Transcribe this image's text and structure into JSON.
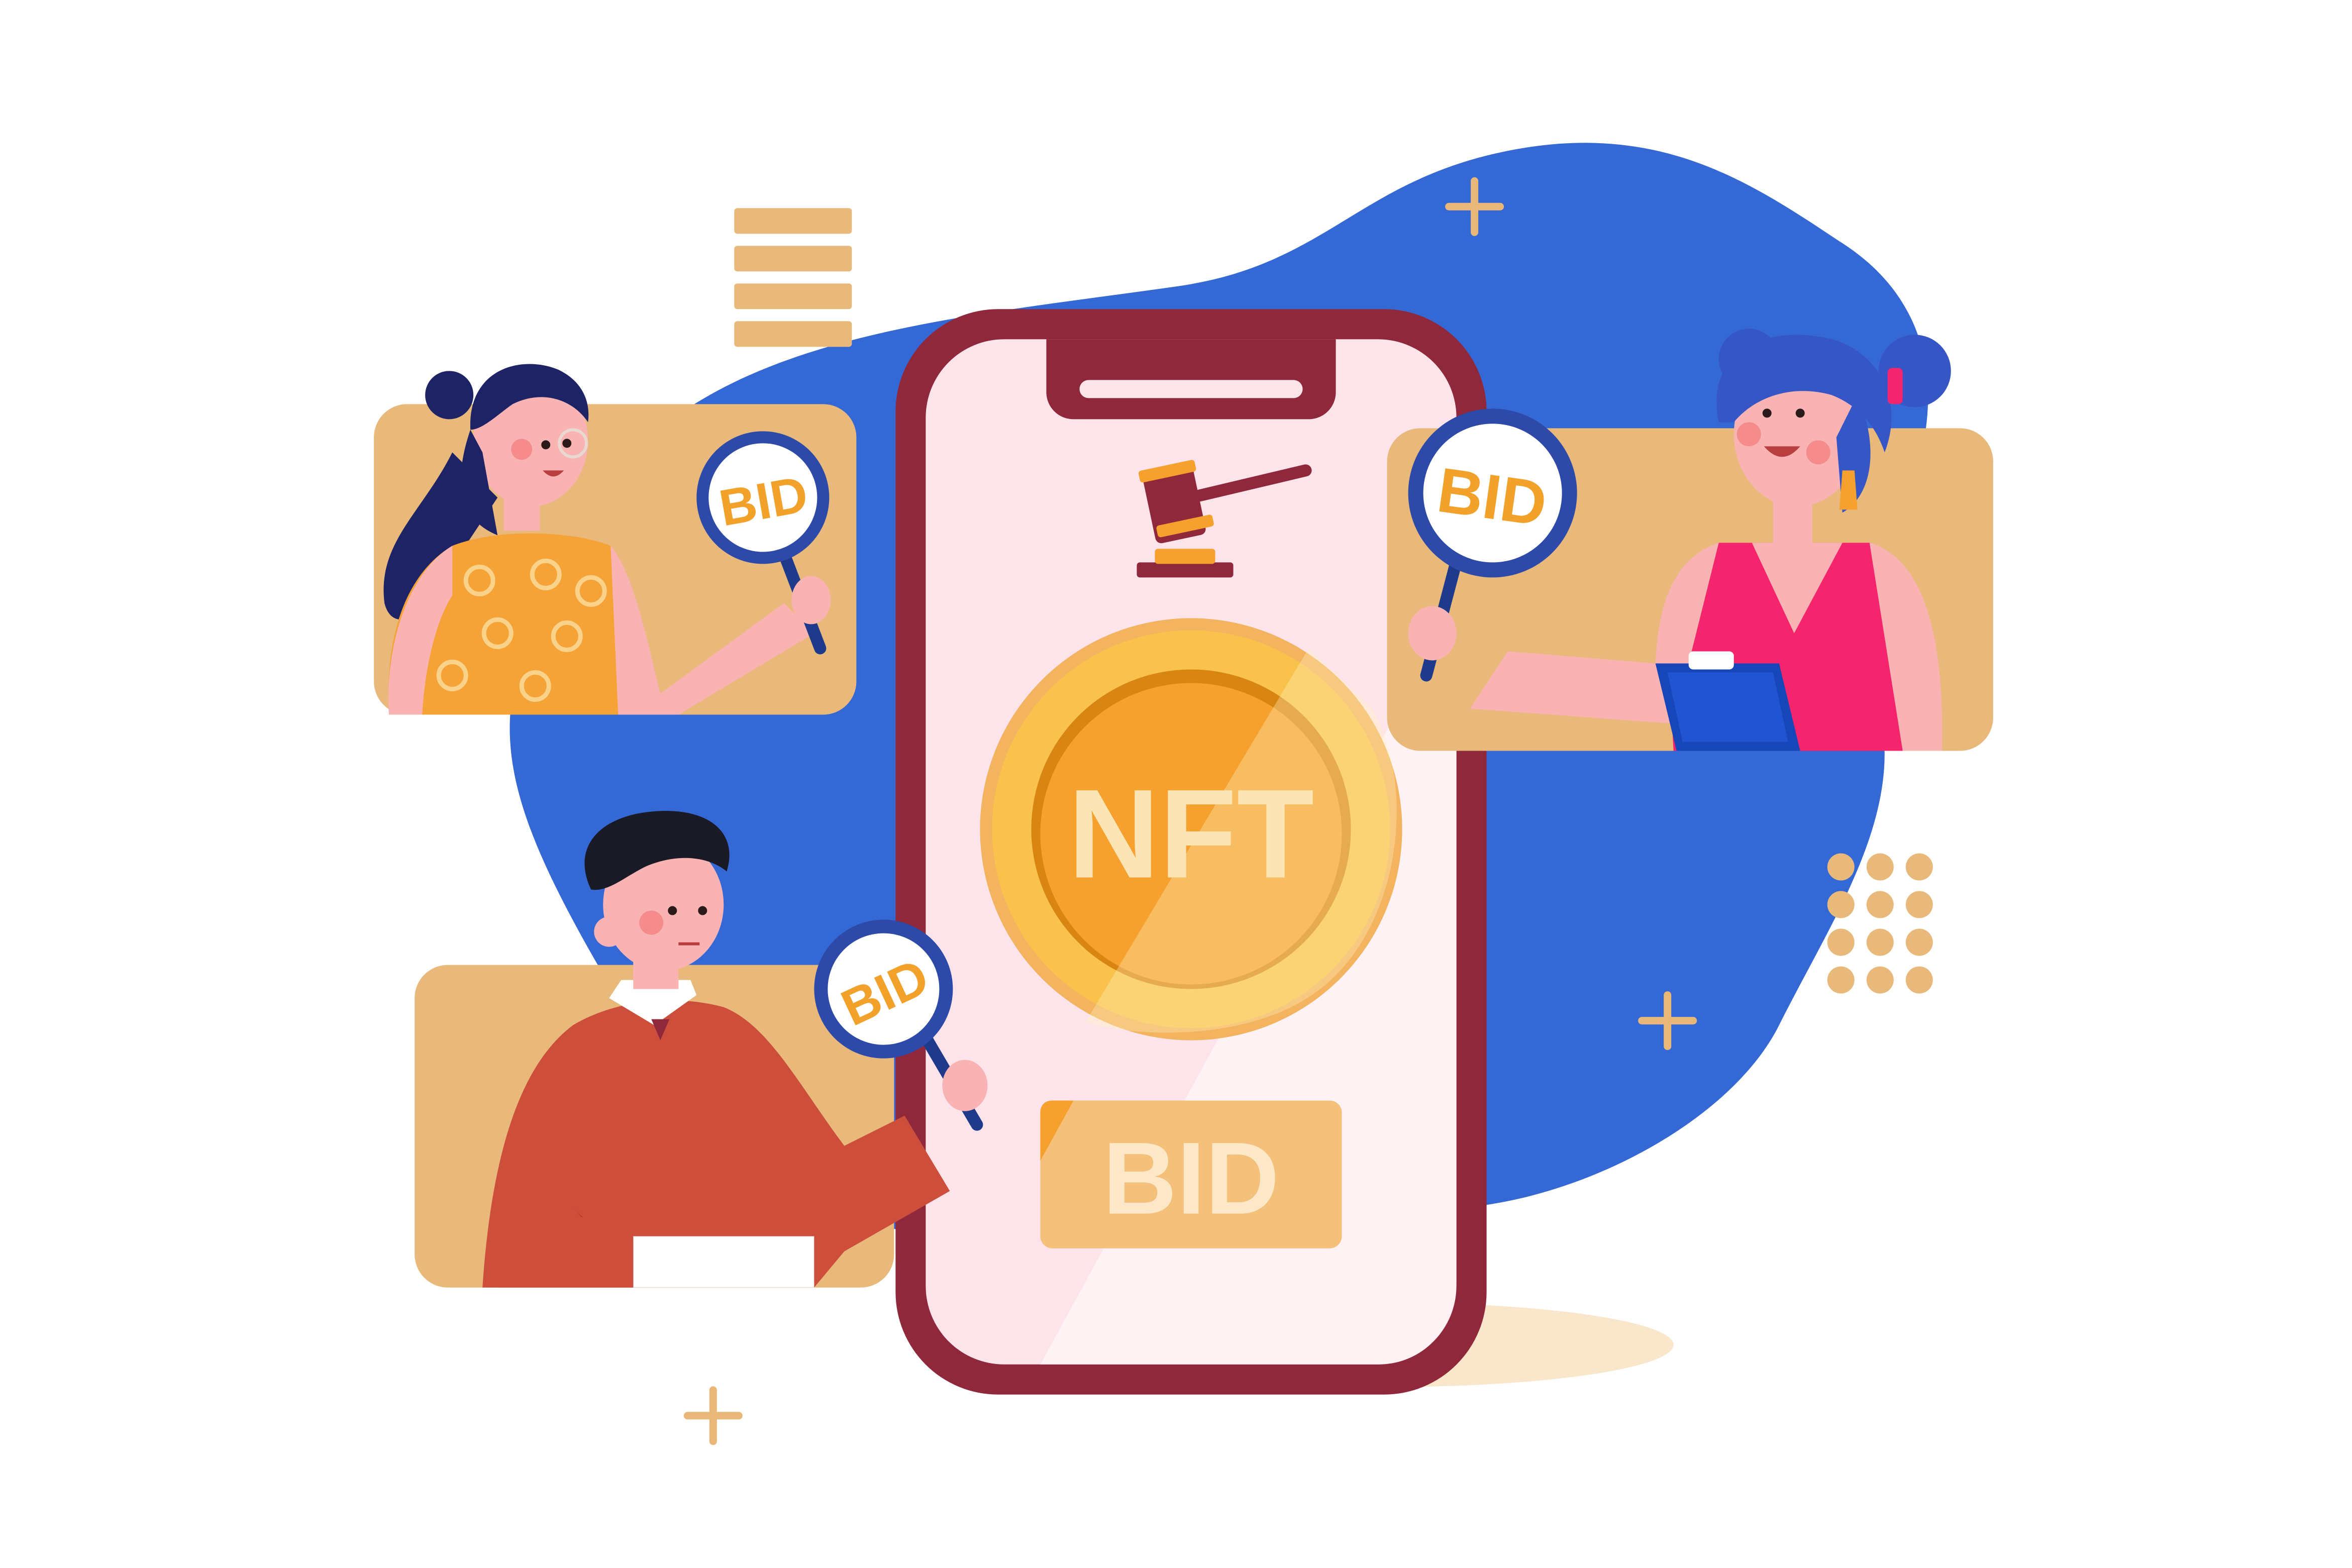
{
  "colors": {
    "blob_blue": "#3468D4",
    "card_tan": "#E8B97B",
    "phone_frame": "#8E283A",
    "phone_screen": "#FDE3EA",
    "coin_outer": "#F8C24C",
    "coin_inner": "#F6A02E",
    "paddle_ring": "#2E4AA8",
    "bid_text": "#F2A12B",
    "accent_plus": "#E9B878"
  },
  "phone": {
    "coin_label": "NFT",
    "bid_button_label": "BID"
  },
  "paddles": {
    "top_left": "BID",
    "right": "BID",
    "bottom_left": "BID"
  },
  "icons": [
    "gavel-icon",
    "plus-icon",
    "dot-grid",
    "stripe-stack"
  ]
}
